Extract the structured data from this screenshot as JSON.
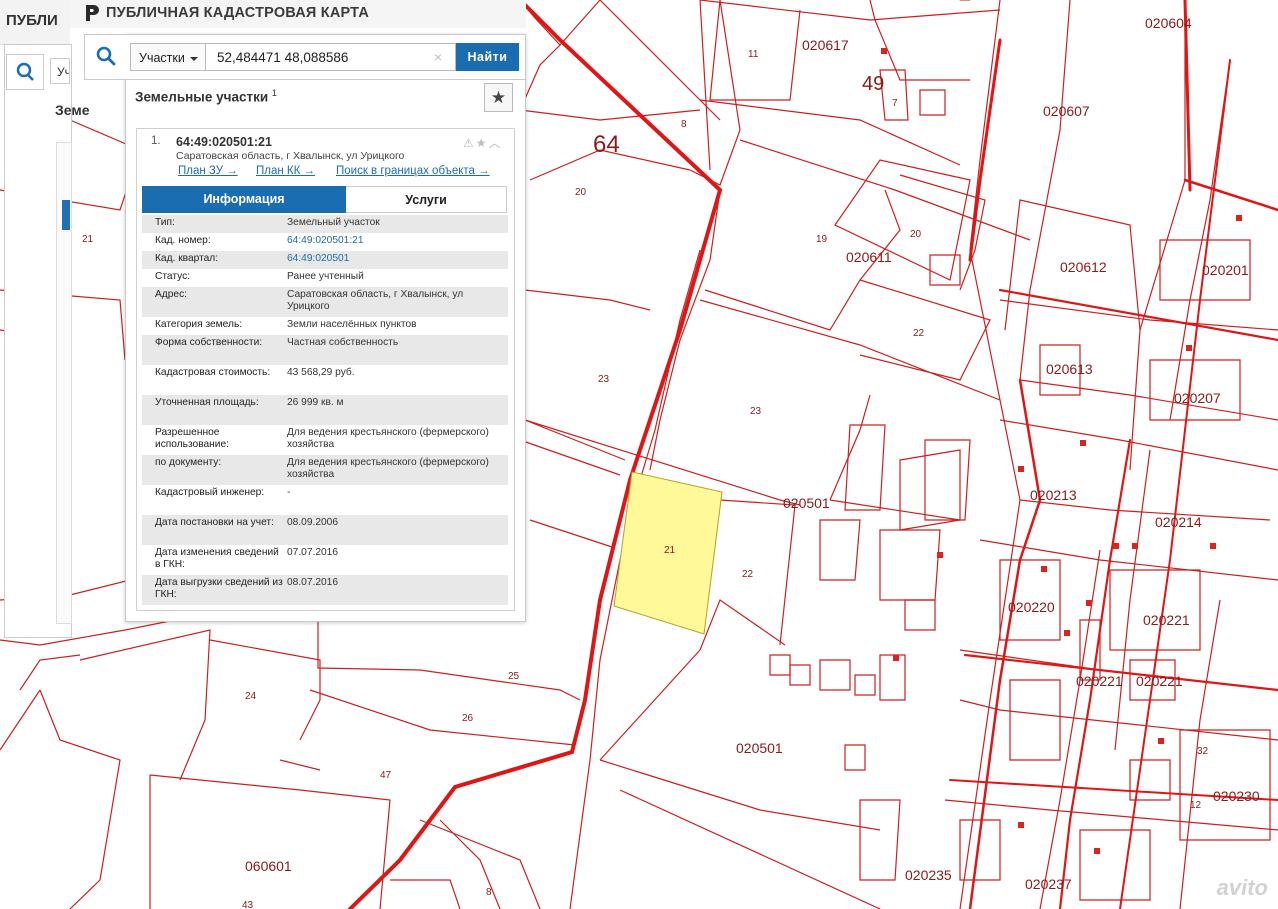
{
  "app": {
    "title": "ПУБЛИЧНАЯ КАДАСТРОВАЯ КАРТА",
    "bg_title": "ПУБЛИ",
    "bg_select": "Уч",
    "bg_label": "Земе"
  },
  "search": {
    "type_label": "Участки",
    "query": "52,484471 48,088586",
    "clear": "×",
    "button": "Найти"
  },
  "results": {
    "title": "Земельные участки",
    "count": "1"
  },
  "card": {
    "index": "1.",
    "cadastral_id": "64:49:020501:21",
    "address": "Саратовская область, г Хвалынск, ул Урицкого",
    "links": [
      "План ЗУ →",
      "План КК →",
      "Поиск в границах объекта →"
    ],
    "tabs": [
      "Информация",
      "Услуги"
    ],
    "rows": [
      {
        "k": "Тип:",
        "v": "Земельный участок"
      },
      {
        "k": "Кад. номер:",
        "v": "64:49:020501:21"
      },
      {
        "k": "Кад. квартал:",
        "v": "64:49:020501"
      },
      {
        "k": "Статус:",
        "v": "Ранее учтенный"
      },
      {
        "k": "Адрес:",
        "v": "Саратовская область, г Хвалынск, ул Урицкого"
      },
      {
        "k": "Категория земель:",
        "v": "Земли населённых пунктов"
      },
      {
        "k": "Форма собственности:",
        "v": "Частная собственность"
      },
      {
        "k": "Кадастровая стоимость:",
        "v": "43 568,29 руб."
      },
      {
        "k": "Уточненная площадь:",
        "v": "26 999 кв. м"
      },
      {
        "k": "Разрешенное использование:",
        "v": "Для ведения крестьянского (фермерского) хозяйства"
      },
      {
        "k": "по документу:",
        "v": "Для ведения крестьянского (фермерского) хозяйства"
      },
      {
        "k": "Кадастровый инженер:",
        "v": "-"
      },
      {
        "k": "Дата постановки на учет:",
        "v": "08.09.2006"
      },
      {
        "k": "Дата изменения сведений в ГКН:",
        "v": "07.07.2016"
      },
      {
        "k": "Дата выгрузки сведений из ГКН:",
        "v": "08.07.2016"
      }
    ]
  },
  "map": {
    "district_labels": [
      "64",
      "49"
    ],
    "quarter_labels": [
      "020617",
      "020604",
      "020607",
      "020611",
      "020612",
      "020201",
      "020613",
      "020207",
      "020501",
      "020213",
      "020214",
      "020220",
      "020221",
      "020221",
      "020221",
      "020501",
      "020230",
      "020235",
      "020237",
      "060601"
    ],
    "parcel_labels": [
      "21",
      "20",
      "23",
      "23",
      "22",
      "22",
      "19",
      "20",
      "22",
      "25",
      "26",
      "24",
      "47",
      "43",
      "11",
      "12",
      "8",
      "7",
      "8"
    ],
    "highlight_color": "#fff99a",
    "line_color": "#cc1f1f"
  },
  "watermark": "avito"
}
